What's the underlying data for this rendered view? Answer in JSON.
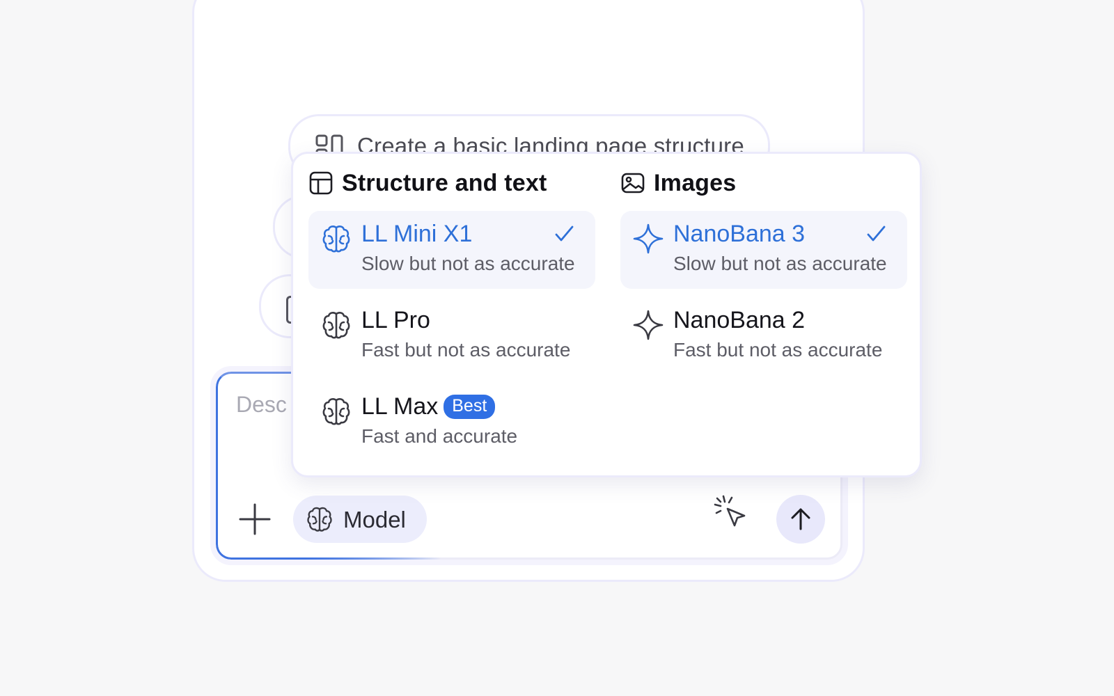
{
  "suggestions": [
    {
      "label": "Create a basic landing page structure",
      "icon": "layout-columns-icon"
    }
  ],
  "composer": {
    "placeholder": "Desc",
    "add_icon": "plus-icon",
    "model_button_label": "Model",
    "model_icon": "brain-icon",
    "pointer_icon": "cursor-click-icon",
    "send_icon": "arrow-up-icon"
  },
  "model_menu": {
    "structure": {
      "title": "Structure and text",
      "icon": "layout-icon",
      "options": [
        {
          "name": "LL Mini X1",
          "description": "Slow but not as accurate",
          "selected": true,
          "icon": "brain-icon"
        },
        {
          "name": "LL Pro",
          "description": "Fast but not as accurate",
          "selected": false,
          "icon": "brain-icon"
        },
        {
          "name": "LL Max",
          "badge": "Best",
          "description": "Fast and accurate",
          "selected": false,
          "icon": "brain-icon"
        }
      ]
    },
    "images": {
      "title": "Images",
      "icon": "image-icon",
      "options": [
        {
          "name": "NanoBana 3",
          "description": "Slow but not as accurate",
          "selected": true,
          "icon": "sparkle-icon"
        },
        {
          "name": "NanoBana 2",
          "description": "Fast but not as accurate",
          "selected": false,
          "icon": "sparkle-icon"
        }
      ]
    }
  },
  "colors": {
    "accent": "#2e70d8",
    "badge": "#2f6fe4",
    "selected_bg": "#f4f5fc",
    "chip_bg": "#ecedfc"
  }
}
